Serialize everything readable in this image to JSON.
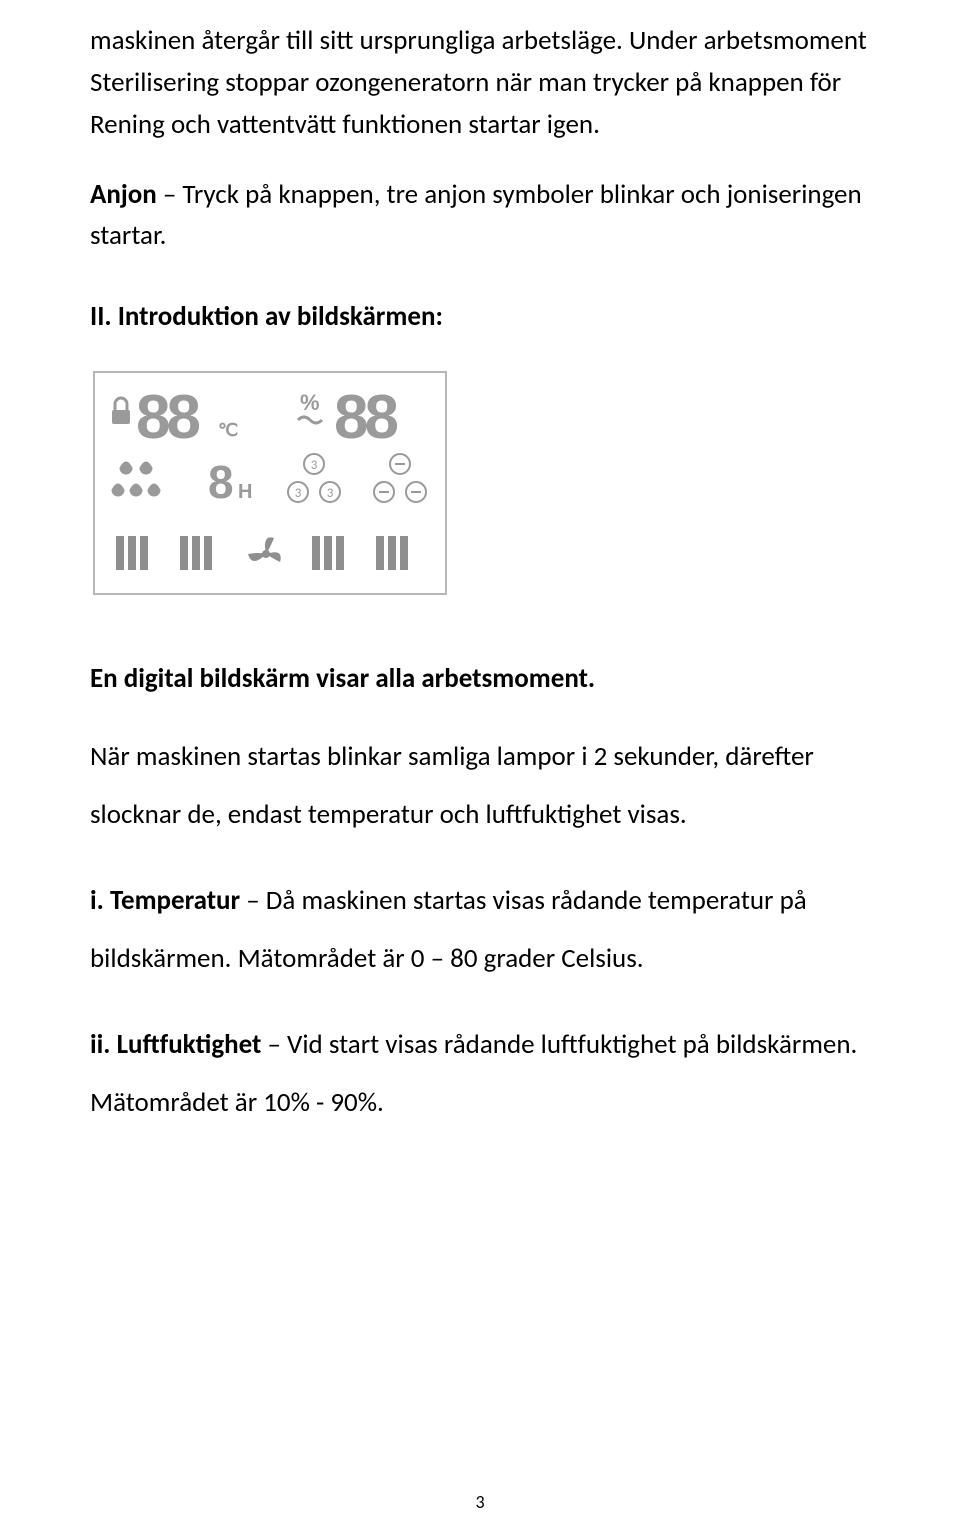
{
  "p1": {
    "t": "maskinen återgår till sitt ursprungliga arbetsläge. Under arbetsmoment Sterilisering stoppar ozongeneratorn när man trycker på knappen för Rening och vattentvätt funktionen startar igen."
  },
  "p2": {
    "label": "Anjon",
    "rest": " – Tryck på knappen, tre anjon symboler blinkar och joniseringen startar."
  },
  "h1": "II. Introduktion av bildskärmen:",
  "p3": "En digital bildskärm visar alla arbetsmoment.",
  "p4": "När maskinen startas blinkar samliga lampor i 2 sekunder, därefter slocknar de, endast temperatur och luftfuktighet visas.",
  "p5": {
    "label": "i. Temperatur",
    "rest": " – Då maskinen startas visas rådande temperatur på bildskärmen. Mätområdet är 0 – 80 grader Celsius."
  },
  "p6": {
    "label": "ii. Luftfuktighet",
    "rest": " – Vid start visas rådande luftfuktighet på bildskärmen. Mätområdet är 10% - 90%."
  },
  "page_number": "3",
  "display": {
    "temp": "88",
    "temp_unit": "℃",
    "humidity": "88",
    "humidity_pct": "%",
    "center_digit": "8",
    "center_h": "H"
  }
}
